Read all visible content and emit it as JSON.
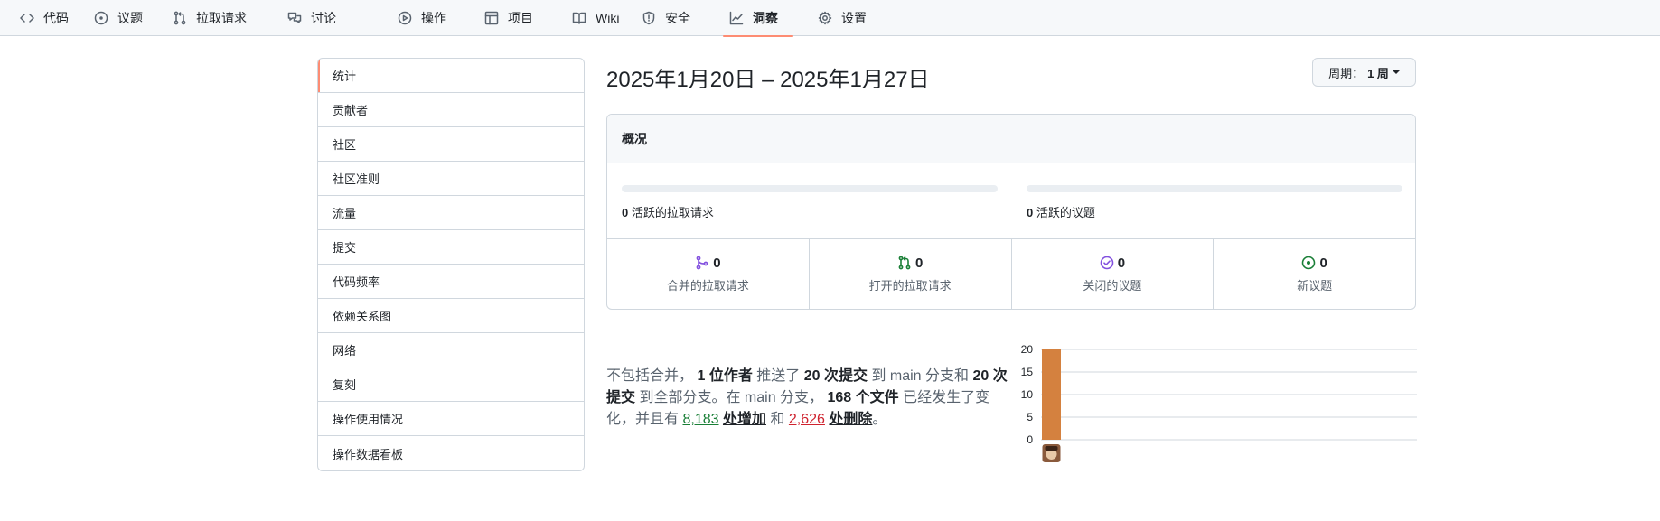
{
  "nav": {
    "items": [
      {
        "label": "代码",
        "icon": "code-icon"
      },
      {
        "label": "议题",
        "icon": "issue-opened-icon"
      },
      {
        "label": "拉取请求",
        "icon": "git-pull-request-icon"
      },
      {
        "label": "讨论",
        "icon": "comment-discussion-icon"
      },
      {
        "label": "操作",
        "icon": "play-icon"
      },
      {
        "label": "项目",
        "icon": "table-icon"
      },
      {
        "label": "Wiki",
        "icon": "book-icon"
      },
      {
        "label": "安全",
        "icon": "shield-icon"
      },
      {
        "label": "洞察",
        "icon": "graph-icon",
        "active": true
      },
      {
        "label": "设置",
        "icon": "gear-icon"
      }
    ]
  },
  "sidebar": {
    "items": [
      {
        "label": "统计",
        "selected": true
      },
      {
        "label": "贡献者"
      },
      {
        "label": "社区"
      },
      {
        "label": "社区准则"
      },
      {
        "label": "流量"
      },
      {
        "label": "提交"
      },
      {
        "label": "代码频率"
      },
      {
        "label": "依赖关系图"
      },
      {
        "label": "网络"
      },
      {
        "label": "复刻"
      },
      {
        "label": "操作使用情况"
      },
      {
        "label": "操作数据看板"
      }
    ]
  },
  "main": {
    "date_range": "2025年1月20日 – 2025年1月27日",
    "period": {
      "label": "周期：",
      "value": "1 周"
    },
    "overview": {
      "title": "概况",
      "active_prs": {
        "count": "0",
        "label": "活跃的拉取请求"
      },
      "active_issues": {
        "count": "0",
        "label": "活跃的议题"
      },
      "stats": [
        {
          "count": "0",
          "label": "合并的拉取请求",
          "icon": "git-merge-icon",
          "color": "#8250df"
        },
        {
          "count": "0",
          "label": "打开的拉取请求",
          "icon": "git-pull-request-icon",
          "color": "#1a7f37"
        },
        {
          "count": "0",
          "label": "关闭的议题",
          "icon": "issue-closed-icon",
          "color": "#8250df"
        },
        {
          "count": "0",
          "label": "新议题",
          "icon": "issue-opened-icon",
          "color": "#1a7f37"
        }
      ]
    },
    "summary": {
      "p1": "不包括合并，",
      "authors": "1 位作者",
      "p2": "推送了",
      "commits_main": "20 次提交",
      "p3": "到 main 分支和",
      "commits_all": "20 次提交",
      "p4": "到全部分支。在 main 分支，",
      "files": "168 个文件",
      "p5": "已经发生了变化，并且有",
      "additions": "8,183",
      "additions_label": "处增加",
      "p6": "和",
      "deletions": "2,626",
      "deletions_label": "处删除",
      "p7": "。"
    }
  },
  "chart_data": {
    "type": "bar",
    "categories": [
      "author-1"
    ],
    "values": [
      20
    ],
    "yticks": [
      "0",
      "5",
      "10",
      "15",
      "20"
    ],
    "ylim": [
      0,
      20
    ],
    "bar_color": "#d4813f",
    "grid": true
  }
}
